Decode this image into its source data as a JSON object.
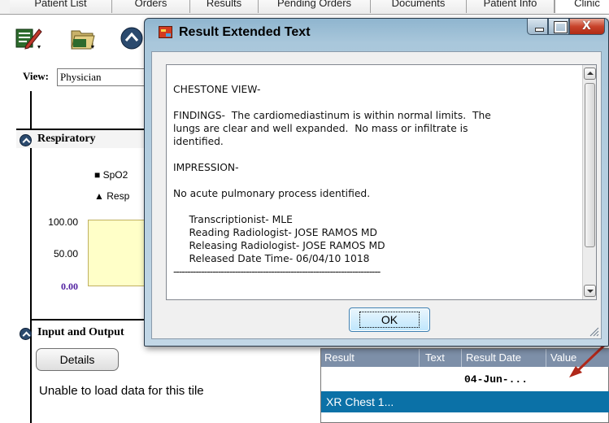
{
  "tabs": [
    "Patient List",
    "Orders",
    "Results",
    "Pending Orders",
    "Documents",
    "Patient Info",
    "Clinic"
  ],
  "background": {
    "view_label": "View:",
    "view_value": "Physician",
    "respiratory_title": "Respiratory",
    "legend": [
      "SpO2",
      "Resp"
    ],
    "y_ticks": [
      "100.00",
      "50.00",
      "0.00"
    ],
    "io_title": "Input and Output",
    "details_label": "Details",
    "unable_text": "Unable to load data for this tile",
    "grid": {
      "columns": [
        "Result",
        "Text",
        "Result Date",
        "Value"
      ],
      "row_date": "04-Jun-...",
      "selected_row": "XR Chest 1..."
    }
  },
  "dialog": {
    "title": "Result Extended Text",
    "lines": [
      "CHESTONE VIEW-",
      "",
      "FINDINGS-  The cardiomediastinum is within normal limits.  The",
      "lungs are clear and well expanded.  No mass or infiltrate is",
      "identified.",
      "",
      "IMPRESSION-",
      "",
      "No acute pulmonary process identified.",
      "",
      "     Transcriptionist- MLE",
      "     Reading Radiologist- JOSE RAMOS MD",
      "     Releasing Radiologist- JOSE RAMOS MD",
      "     Released Date Time- 06/04/10 1018",
      "--------------------------------------------------------------------------"
    ],
    "ok_label": "OK"
  },
  "colors": {
    "accent_selected": "#0b71a7",
    "grid_header": "#7d8fa8",
    "arrow": "#b0281a"
  }
}
